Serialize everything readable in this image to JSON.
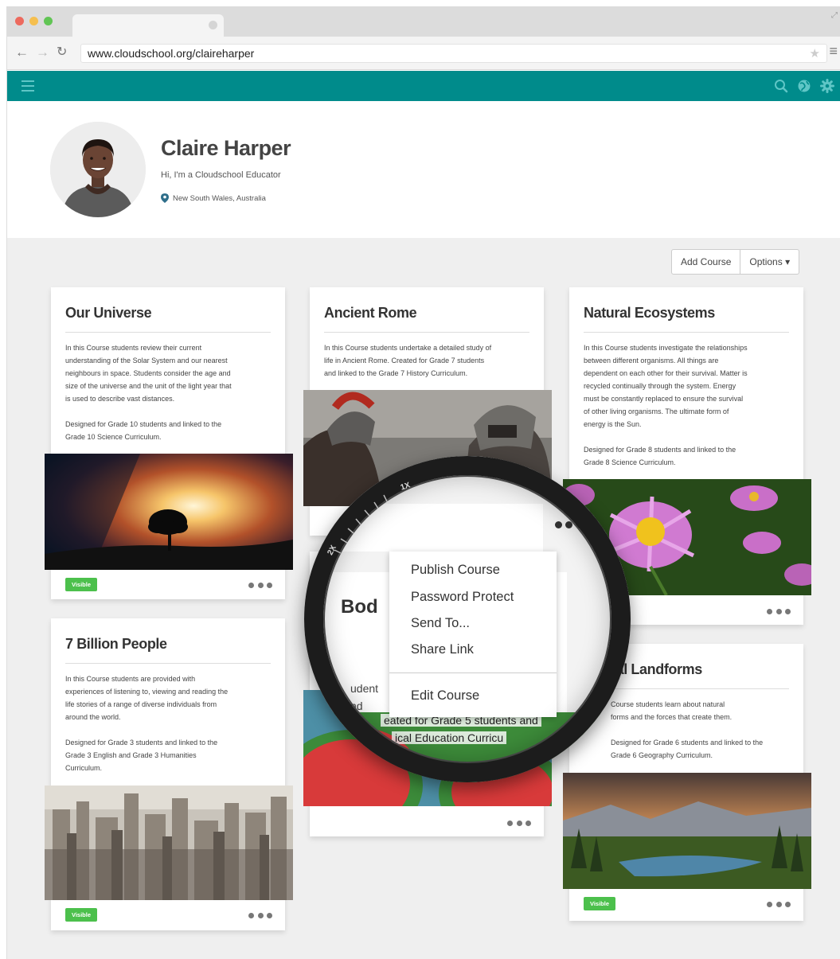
{
  "browser": {
    "url": "www.cloudschool.org/claireharper"
  },
  "profile": {
    "name": "Claire Harper",
    "bio": "Hi, I'm a Cloudschool Educator",
    "location": "New South Wales, Australia"
  },
  "toolbar": {
    "add_course": "Add Course",
    "options": "Options ▾"
  },
  "courses": [
    {
      "title": "Our Universe",
      "description": "In this Course students review their current\nunderstanding of the Solar System and our nearest\nneighbours in space. Students consider the age and\nsize of the universe and the unit of the light year that\nis used to describe vast distances.\n\nDesigned for Grade 10 students and linked to the\nGrade 10 Science Curriculum.",
      "status": "Visible"
    },
    {
      "title": "Ancient Rome",
      "description": "In this Course students undertake a detailed study of\nlife in Ancient Rome. Created for Grade 7 students\nand linked to the Grade 7 History Curriculum."
    },
    {
      "title": "Natural Ecosystems",
      "description": "In this Course students investigate the relationships\nbetween different organisms. All things are\ndependent on each other for their survival. Matter is\nrecycled continually through the system. Energy\nmust be constantly replaced to ensure the survival\nof other living organisms. The ultimate form of\nenergy is the Sun.\n\nDesigned for Grade 8 students and linked to the\nGrade 8 Science Curriculum."
    },
    {
      "title": "7 Billion People",
      "description": "In this Course students are provided with\nexperiences of listening to, viewing and reading the\nlife stories of a range of diverse individuals from\naround the world.\n\nDesigned for Grade 3 students and linked to the\nGrade 3 English and Grade 3 Humanities\nCurriculum.",
      "status": "Visible"
    },
    {
      "title": "Natural Landforms",
      "title_visible": "ral Landforms",
      "description": "Course students learn about natural\nforms and the forces that create them.\n\nDesigned for Grade 6 students and linked to the\nGrade 6 Geography Curriculum.",
      "status": "Visible"
    }
  ],
  "magnifier": {
    "scale_1x": "1X",
    "scale_2x": "2X",
    "partial_title": "Bod",
    "partial_text_1": "udent",
    "partial_text_2": "nd",
    "partial_text_3": "eated for Grade 5 students and",
    "partial_text_4": "ical Education Curricu",
    "menu": {
      "publish": "Publish Course",
      "password": "Password Protect",
      "send": "Send To...",
      "share": "Share Link",
      "edit": "Edit Course"
    }
  },
  "colors": {
    "brand": "#008b8b",
    "visible_badge": "#4cc04c"
  }
}
